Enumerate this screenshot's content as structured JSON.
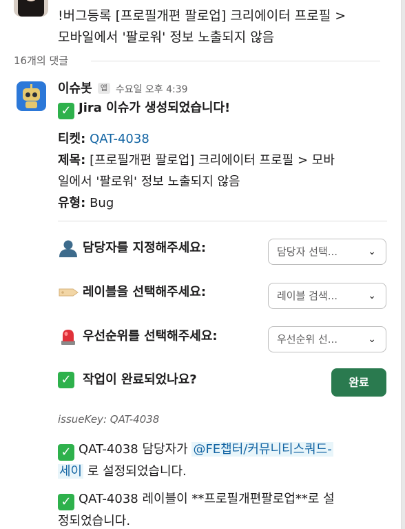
{
  "parent": {
    "text_line1": "!버그등록 [프로필개편 팔로업] 크리에이터 프로필 >",
    "text_line2": "모바일에서 '팔로워' 정보 노출되지 않음"
  },
  "thread": {
    "reply_count": "16개의 댓글"
  },
  "message": {
    "sender": "이슈봇",
    "app_badge": "앱",
    "timestamp": "수요일 오후 4:39",
    "title": "Jira 이슈가 생성되었습니다!",
    "ticket_label": "티켓:",
    "ticket_value": "QAT-4038",
    "subject_label": "제목:",
    "subject_line1": "[프로필개편 팔로업] 크리에이터 프로필 > 모바",
    "subject_line2": "일에서 '팔로워' 정보 노출되지 않음",
    "type_label": "유형:",
    "type_value": "Bug"
  },
  "actions": {
    "assignee_label": "담당자를 지정해주세요:",
    "assignee_placeholder": "담당자 선택...",
    "label_label": "레이블을 선택해주세요:",
    "label_placeholder": "레이블 검색...",
    "priority_label": "우선순위를 선택해주세요:",
    "priority_placeholder": "우선순위 선...",
    "complete_question": "작업이 완료되었나요?",
    "complete_button": "완료"
  },
  "issue_key_text": "issueKey: QAT-4038",
  "results": {
    "assignee_prefix": "QAT-4038 담당자가",
    "assignee_mention_1": "@FE챕터/커뮤니티스쿼드-",
    "assignee_mention_2": "세이",
    "assignee_suffix": "로 설정되었습니다.",
    "label_line1": "QAT-4038 레이블이 **프로필개편팔로업**로 설",
    "label_line2": "정되었습니다."
  },
  "icons": {
    "check": "white-check-mark",
    "assignee": "bust-in-silhouette",
    "label": "label-tag",
    "priority": "rotating-light"
  },
  "colors": {
    "link": "#1264a3",
    "primary_button": "#2a7a4f",
    "check": "#2eb14c"
  }
}
